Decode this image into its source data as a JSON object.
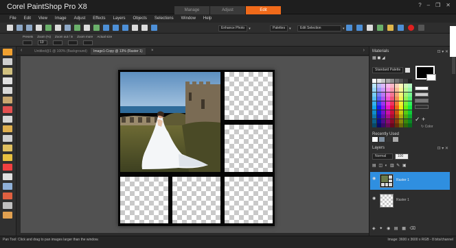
{
  "app": {
    "title": "Corel PaintShop Pro X8",
    "window_controls": [
      "?",
      "–",
      "❐",
      "✕"
    ]
  },
  "workspace_tabs": [
    {
      "label": "Manage",
      "active": false
    },
    {
      "label": "Adjust",
      "active": false
    },
    {
      "label": "Edit",
      "active": true
    }
  ],
  "menu": [
    "File",
    "Edit",
    "View",
    "Image",
    "Adjust",
    "Effects",
    "Layers",
    "Objects",
    "Selections",
    "Window",
    "Help"
  ],
  "toolbar": {
    "selects": [
      "Enhance Photo",
      "Palettes",
      "Edit Selection"
    ],
    "select_arrows": [
      "▾",
      "▾",
      "▾"
    ]
  },
  "options": {
    "labels": [
      "Presets",
      "Zoom (%)",
      "Zoom out / in",
      "Zoom more",
      "Actual size"
    ],
    "zoom_value": "13"
  },
  "documents": [
    {
      "label": "Untitled@1 @ 100% (Background)",
      "active": false
    },
    {
      "label": "Image1-Copy @ 13% (Raster 1)",
      "active": true
    }
  ],
  "nav": {
    "left": "‹",
    "right": "›"
  },
  "materials": {
    "title": "Materials",
    "palette_select": "Standard Palette",
    "transparent_label": "↻ Color",
    "recent_label": "Recently Used",
    "colors": {
      "foreground": "#000000",
      "background": "#ffffff"
    }
  },
  "layers": {
    "title": "Layers",
    "blend_mode": "Normal",
    "opacity": "100",
    "items": [
      {
        "name": "Raster 1",
        "selected": true
      },
      {
        "name": "Raster 1",
        "selected": false
      }
    ]
  },
  "status": {
    "hint": "Pan Tool: Click and drag to pan images larger than the window.",
    "image_info": "Image: 3600 x 3600 x RGB - 8 bits/channel"
  },
  "colors": {
    "accent": "#f06a1a",
    "selection": "#2f8fe0",
    "record": "#e02020"
  },
  "icons": [
    "new-icon",
    "open-icon",
    "save-icon",
    "print-icon",
    "undo-icon",
    "redo-icon",
    "zoom-icon",
    "pan-tool-icon",
    "record-icon"
  ]
}
